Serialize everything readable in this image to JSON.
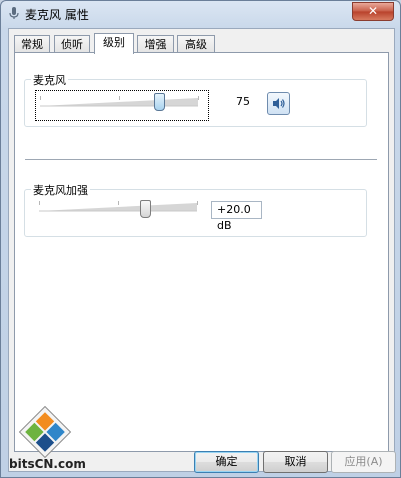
{
  "window": {
    "title": "麦克风 属性",
    "close_glyph": "✕"
  },
  "tabs": [
    {
      "label": "常规",
      "active": false
    },
    {
      "label": "侦听",
      "active": false
    },
    {
      "label": "级别",
      "active": true
    },
    {
      "label": "增强",
      "active": false
    },
    {
      "label": "高级",
      "active": false
    }
  ],
  "microphone": {
    "label": "麦克风",
    "level": 75,
    "level_text": "75",
    "speaker_icon": "speaker-icon"
  },
  "boost": {
    "label": "麦克风加强",
    "value_text": "+20.0 dB",
    "level_fraction": 0.67
  },
  "buttons": {
    "ok": "确定",
    "cancel": "取消",
    "apply": "应用(A)"
  },
  "watermark": {
    "text": "bitsCN.com"
  },
  "colors": {
    "accent": "#3c7fb1",
    "title_bar": "#c9d8ea",
    "close_button": "#c75c46"
  }
}
